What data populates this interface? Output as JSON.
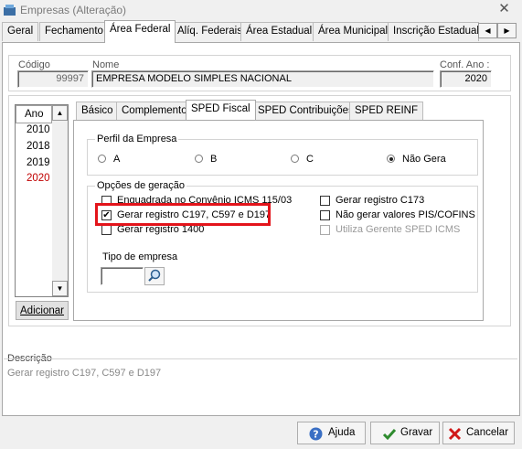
{
  "window": {
    "title": "Empresas (Alteração)"
  },
  "main_tabs": [
    "Geral",
    "Fechamento",
    "Área Federal",
    "Alíq. Federais",
    "Área Estadual",
    "Área Municipal",
    "Inscrição Estadual S"
  ],
  "main_active_tab": "Área Federal",
  "company": {
    "codigo_label": "Código",
    "codigo_value": "99997",
    "nome_label": "Nome",
    "nome_value": "EMPRESA MODELO SIMPLES NACIONAL",
    "conf_ano_label": "Conf. Ano :",
    "conf_ano_value": "2020"
  },
  "years": {
    "header": "Ano",
    "items": [
      "2010",
      "2018",
      "2019",
      "2020"
    ],
    "selected": "2020"
  },
  "adicionar_label": "Adicionar",
  "sub_tabs": [
    "Básico",
    "Complemento",
    "SPED Fiscal",
    "SPED Contribuições",
    "SPED REINF"
  ],
  "sub_active_tab": "SPED Fiscal",
  "perfil": {
    "title": "Perfil da Empresa",
    "options": [
      "A",
      "B",
      "C",
      "Não Gera"
    ],
    "selected": "Não Gera"
  },
  "opcoes": {
    "title": "Opções de geração",
    "left": [
      {
        "label": "Enquadrada no Convênio ICMS 115/03",
        "checked": false
      },
      {
        "label": "Gerar registro C197, C597 e D197",
        "checked": true
      },
      {
        "label": "Gerar registro 1400",
        "checked": false
      }
    ],
    "right": [
      {
        "label": "Gerar registro C173",
        "checked": false,
        "disabled": false
      },
      {
        "label": "Não gerar valores PIS/COFINS",
        "checked": false,
        "disabled": false
      },
      {
        "label": "Utiliza Gerente SPED ICMS",
        "checked": false,
        "disabled": true
      }
    ]
  },
  "tipo_empresa": {
    "label": "Tipo de empresa",
    "value": ""
  },
  "descricao": {
    "label": "Descrição",
    "text": "Gerar registro C197, C597 e D197"
  },
  "footer": {
    "ajuda": "Ajuda",
    "gravar": "Gravar",
    "cancelar": "Cancelar"
  },
  "colors": {
    "highlight_red": "#e3141b",
    "selected_year": "#c00000"
  }
}
